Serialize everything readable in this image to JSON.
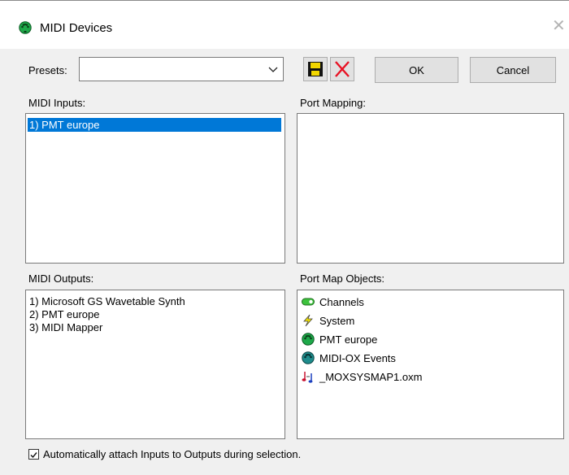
{
  "window": {
    "title": "MIDI Devices",
    "app_icon": "green-midi-port-icon",
    "close_icon": "close-icon"
  },
  "presets": {
    "label": "Presets:",
    "value": ""
  },
  "toolbar": {
    "save_icon": "floppy-save-icon",
    "delete_icon": "red-x-delete-icon",
    "ok_label": "OK",
    "cancel_label": "Cancel"
  },
  "inputs": {
    "label": "MIDI Inputs:",
    "items": [
      "1) PMT europe"
    ],
    "selected_index": 0
  },
  "port_mapping": {
    "label": "Port Mapping:"
  },
  "outputs": {
    "label": "MIDI Outputs:",
    "items": [
      "1) Microsoft GS Wavetable Synth",
      "2) PMT europe",
      "3) MIDI Mapper"
    ]
  },
  "port_map_objects": {
    "label": "Port Map Objects:",
    "items": [
      {
        "label": "Channels",
        "icon": "green-channels-icon"
      },
      {
        "label": "System",
        "icon": "lightning-system-icon"
      },
      {
        "label": "PMT europe",
        "icon": "green-midi-port-icon"
      },
      {
        "label": "MIDI-OX Events",
        "icon": "teal-midi-port-icon"
      },
      {
        "label": "_MOXSYSMAP1.oxm",
        "icon": "music-notes-file-icon"
      }
    ]
  },
  "auto_attach": {
    "label": "Automatically attach Inputs to Outputs during selection.",
    "checked": true
  },
  "colors": {
    "selection": "#0078d7",
    "dialog_bg": "#f0f0f0",
    "delete_red": "#e81123",
    "midi_green": "#1ea94a",
    "midi_teal": "#1e8c8c"
  }
}
